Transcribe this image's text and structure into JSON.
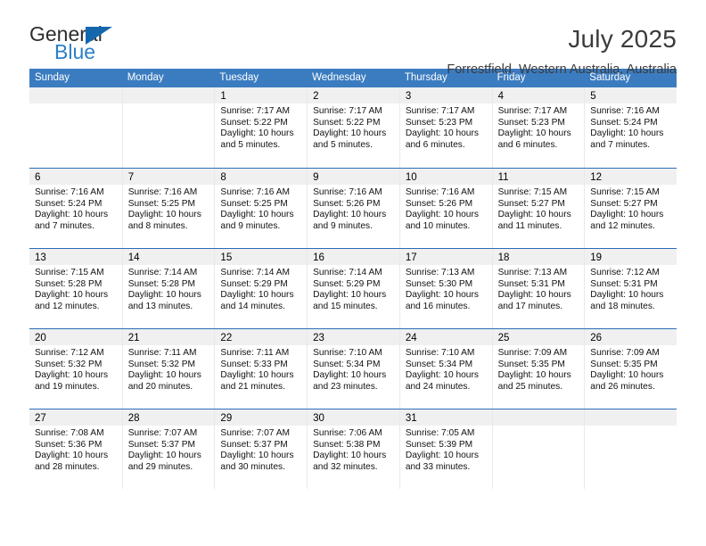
{
  "brand": {
    "name_top": "General",
    "name_bottom": "Blue",
    "triangle_icon": "triangle-icon",
    "color_top": "#2e2e2e",
    "color_bottom": "#2a7fc9",
    "triangle_color": "#1567ad"
  },
  "header": {
    "title": "July 2025",
    "location": "Forrestfield, Western Australia, Australia"
  },
  "theme": {
    "header_blue": "#3b7cc0",
    "row_rule_blue": "#2a6db5",
    "daynum_band": "#f0f0f0"
  },
  "weekdays": [
    "Sunday",
    "Monday",
    "Tuesday",
    "Wednesday",
    "Thursday",
    "Friday",
    "Saturday"
  ],
  "weeks": [
    [
      {
        "day": "",
        "sunrise": "",
        "sunset": "",
        "daylight_1": "",
        "daylight_2": "",
        "empty": true
      },
      {
        "day": "",
        "sunrise": "",
        "sunset": "",
        "daylight_1": "",
        "daylight_2": "",
        "empty": true
      },
      {
        "day": "1",
        "sunrise": "Sunrise: 7:17 AM",
        "sunset": "Sunset: 5:22 PM",
        "daylight_1": "Daylight: 10 hours",
        "daylight_2": "and 5 minutes."
      },
      {
        "day": "2",
        "sunrise": "Sunrise: 7:17 AM",
        "sunset": "Sunset: 5:22 PM",
        "daylight_1": "Daylight: 10 hours",
        "daylight_2": "and 5 minutes."
      },
      {
        "day": "3",
        "sunrise": "Sunrise: 7:17 AM",
        "sunset": "Sunset: 5:23 PM",
        "daylight_1": "Daylight: 10 hours",
        "daylight_2": "and 6 minutes."
      },
      {
        "day": "4",
        "sunrise": "Sunrise: 7:17 AM",
        "sunset": "Sunset: 5:23 PM",
        "daylight_1": "Daylight: 10 hours",
        "daylight_2": "and 6 minutes."
      },
      {
        "day": "5",
        "sunrise": "Sunrise: 7:16 AM",
        "sunset": "Sunset: 5:24 PM",
        "daylight_1": "Daylight: 10 hours",
        "daylight_2": "and 7 minutes."
      }
    ],
    [
      {
        "day": "6",
        "sunrise": "Sunrise: 7:16 AM",
        "sunset": "Sunset: 5:24 PM",
        "daylight_1": "Daylight: 10 hours",
        "daylight_2": "and 7 minutes."
      },
      {
        "day": "7",
        "sunrise": "Sunrise: 7:16 AM",
        "sunset": "Sunset: 5:25 PM",
        "daylight_1": "Daylight: 10 hours",
        "daylight_2": "and 8 minutes."
      },
      {
        "day": "8",
        "sunrise": "Sunrise: 7:16 AM",
        "sunset": "Sunset: 5:25 PM",
        "daylight_1": "Daylight: 10 hours",
        "daylight_2": "and 9 minutes."
      },
      {
        "day": "9",
        "sunrise": "Sunrise: 7:16 AM",
        "sunset": "Sunset: 5:26 PM",
        "daylight_1": "Daylight: 10 hours",
        "daylight_2": "and 9 minutes."
      },
      {
        "day": "10",
        "sunrise": "Sunrise: 7:16 AM",
        "sunset": "Sunset: 5:26 PM",
        "daylight_1": "Daylight: 10 hours",
        "daylight_2": "and 10 minutes."
      },
      {
        "day": "11",
        "sunrise": "Sunrise: 7:15 AM",
        "sunset": "Sunset: 5:27 PM",
        "daylight_1": "Daylight: 10 hours",
        "daylight_2": "and 11 minutes."
      },
      {
        "day": "12",
        "sunrise": "Sunrise: 7:15 AM",
        "sunset": "Sunset: 5:27 PM",
        "daylight_1": "Daylight: 10 hours",
        "daylight_2": "and 12 minutes."
      }
    ],
    [
      {
        "day": "13",
        "sunrise": "Sunrise: 7:15 AM",
        "sunset": "Sunset: 5:28 PM",
        "daylight_1": "Daylight: 10 hours",
        "daylight_2": "and 12 minutes."
      },
      {
        "day": "14",
        "sunrise": "Sunrise: 7:14 AM",
        "sunset": "Sunset: 5:28 PM",
        "daylight_1": "Daylight: 10 hours",
        "daylight_2": "and 13 minutes."
      },
      {
        "day": "15",
        "sunrise": "Sunrise: 7:14 AM",
        "sunset": "Sunset: 5:29 PM",
        "daylight_1": "Daylight: 10 hours",
        "daylight_2": "and 14 minutes."
      },
      {
        "day": "16",
        "sunrise": "Sunrise: 7:14 AM",
        "sunset": "Sunset: 5:29 PM",
        "daylight_1": "Daylight: 10 hours",
        "daylight_2": "and 15 minutes."
      },
      {
        "day": "17",
        "sunrise": "Sunrise: 7:13 AM",
        "sunset": "Sunset: 5:30 PM",
        "daylight_1": "Daylight: 10 hours",
        "daylight_2": "and 16 minutes."
      },
      {
        "day": "18",
        "sunrise": "Sunrise: 7:13 AM",
        "sunset": "Sunset: 5:31 PM",
        "daylight_1": "Daylight: 10 hours",
        "daylight_2": "and 17 minutes."
      },
      {
        "day": "19",
        "sunrise": "Sunrise: 7:12 AM",
        "sunset": "Sunset: 5:31 PM",
        "daylight_1": "Daylight: 10 hours",
        "daylight_2": "and 18 minutes."
      }
    ],
    [
      {
        "day": "20",
        "sunrise": "Sunrise: 7:12 AM",
        "sunset": "Sunset: 5:32 PM",
        "daylight_1": "Daylight: 10 hours",
        "daylight_2": "and 19 minutes."
      },
      {
        "day": "21",
        "sunrise": "Sunrise: 7:11 AM",
        "sunset": "Sunset: 5:32 PM",
        "daylight_1": "Daylight: 10 hours",
        "daylight_2": "and 20 minutes."
      },
      {
        "day": "22",
        "sunrise": "Sunrise: 7:11 AM",
        "sunset": "Sunset: 5:33 PM",
        "daylight_1": "Daylight: 10 hours",
        "daylight_2": "and 21 minutes."
      },
      {
        "day": "23",
        "sunrise": "Sunrise: 7:10 AM",
        "sunset": "Sunset: 5:34 PM",
        "daylight_1": "Daylight: 10 hours",
        "daylight_2": "and 23 minutes."
      },
      {
        "day": "24",
        "sunrise": "Sunrise: 7:10 AM",
        "sunset": "Sunset: 5:34 PM",
        "daylight_1": "Daylight: 10 hours",
        "daylight_2": "and 24 minutes."
      },
      {
        "day": "25",
        "sunrise": "Sunrise: 7:09 AM",
        "sunset": "Sunset: 5:35 PM",
        "daylight_1": "Daylight: 10 hours",
        "daylight_2": "and 25 minutes."
      },
      {
        "day": "26",
        "sunrise": "Sunrise: 7:09 AM",
        "sunset": "Sunset: 5:35 PM",
        "daylight_1": "Daylight: 10 hours",
        "daylight_2": "and 26 minutes."
      }
    ],
    [
      {
        "day": "27",
        "sunrise": "Sunrise: 7:08 AM",
        "sunset": "Sunset: 5:36 PM",
        "daylight_1": "Daylight: 10 hours",
        "daylight_2": "and 28 minutes."
      },
      {
        "day": "28",
        "sunrise": "Sunrise: 7:07 AM",
        "sunset": "Sunset: 5:37 PM",
        "daylight_1": "Daylight: 10 hours",
        "daylight_2": "and 29 minutes."
      },
      {
        "day": "29",
        "sunrise": "Sunrise: 7:07 AM",
        "sunset": "Sunset: 5:37 PM",
        "daylight_1": "Daylight: 10 hours",
        "daylight_2": "and 30 minutes."
      },
      {
        "day": "30",
        "sunrise": "Sunrise: 7:06 AM",
        "sunset": "Sunset: 5:38 PM",
        "daylight_1": "Daylight: 10 hours",
        "daylight_2": "and 32 minutes."
      },
      {
        "day": "31",
        "sunrise": "Sunrise: 7:05 AM",
        "sunset": "Sunset: 5:39 PM",
        "daylight_1": "Daylight: 10 hours",
        "daylight_2": "and 33 minutes."
      },
      {
        "day": "",
        "sunrise": "",
        "sunset": "",
        "daylight_1": "",
        "daylight_2": "",
        "empty": true
      },
      {
        "day": "",
        "sunrise": "",
        "sunset": "",
        "daylight_1": "",
        "daylight_2": "",
        "empty": true
      }
    ]
  ]
}
